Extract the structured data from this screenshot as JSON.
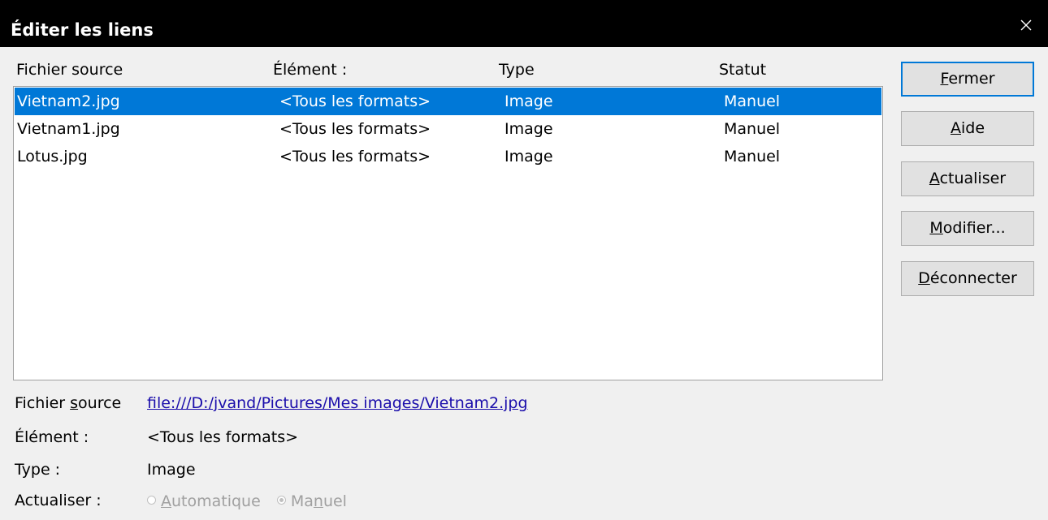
{
  "window": {
    "title": "Éditer les liens",
    "close_icon": "close-icon"
  },
  "list": {
    "columns": [
      "Fichier source",
      "Élément :",
      "Type",
      "Statut"
    ],
    "rows": [
      {
        "source": "Vietnam2.jpg",
        "element": "<Tous les formats>",
        "type": "Image",
        "status": "Manuel",
        "selected": true
      },
      {
        "source": "Vietnam1.jpg",
        "element": "<Tous les formats>",
        "type": "Image",
        "status": "Manuel",
        "selected": false
      },
      {
        "source": "Lotus.jpg",
        "element": "<Tous les formats>",
        "type": "Image",
        "status": "Manuel",
        "selected": false
      }
    ]
  },
  "buttons": {
    "close": {
      "mnemonic": "F",
      "rest": "ermer"
    },
    "help": {
      "mnemonic": "A",
      "rest": "ide"
    },
    "update": {
      "mnemonic": "A",
      "rest": "ctualiser"
    },
    "modify": {
      "mnemonic": "M",
      "rest": "odifier..."
    },
    "disconnect": {
      "mnemonic": "D",
      "rest": "éconnecter"
    }
  },
  "details": {
    "source_label_pre": "Fichier ",
    "source_label_mnemonic": "s",
    "source_label_post": "ource",
    "source_value": "file:///D:/jvand/Pictures/Mes images/Vietnam2.jpg",
    "element_label": "Élément :",
    "element_value": "<Tous les formats>",
    "type_label": "Type :",
    "type_value": "Image",
    "update_label": "Actualiser :",
    "auto": {
      "mnemonic": "A",
      "rest": "utomatique"
    },
    "manual": {
      "pre": "Ma",
      "mnemonic": "n",
      "post": "uel"
    }
  },
  "colors": {
    "accent": "#0078d7",
    "titlebar": "#000000",
    "link": "#1a0dab"
  }
}
